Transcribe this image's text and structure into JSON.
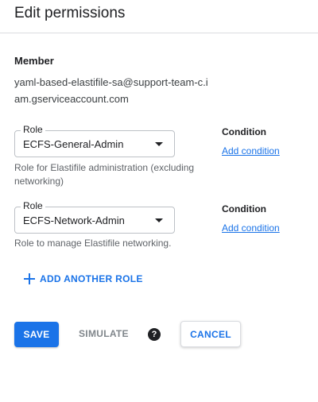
{
  "header": {
    "title": "Edit permissions"
  },
  "member": {
    "label": "Member",
    "value": "yaml-based-elastifile-sa@support-team-c.iam.gserviceaccount.com"
  },
  "roles": [
    {
      "label": "Role",
      "value": "ECFS-General-Admin",
      "description": "Role for Elastifile administration (excluding networking)",
      "condition_label": "Condition",
      "condition_link": "Add condition"
    },
    {
      "label": "Role",
      "value": "ECFS-Network-Admin",
      "description": "Role to manage Elastifile networking.",
      "condition_label": "Condition",
      "condition_link": "Add condition"
    }
  ],
  "add_role_label": "ADD ANOTHER ROLE",
  "actions": {
    "save_label": "SAVE",
    "simulate_label": "SIMULATE",
    "help_glyph": "?",
    "cancel_label": "CANCEL"
  },
  "colors": {
    "accent": "#1a73e8",
    "text": "#202124",
    "secondary_text": "#5f6368",
    "border": "#dadce0"
  }
}
